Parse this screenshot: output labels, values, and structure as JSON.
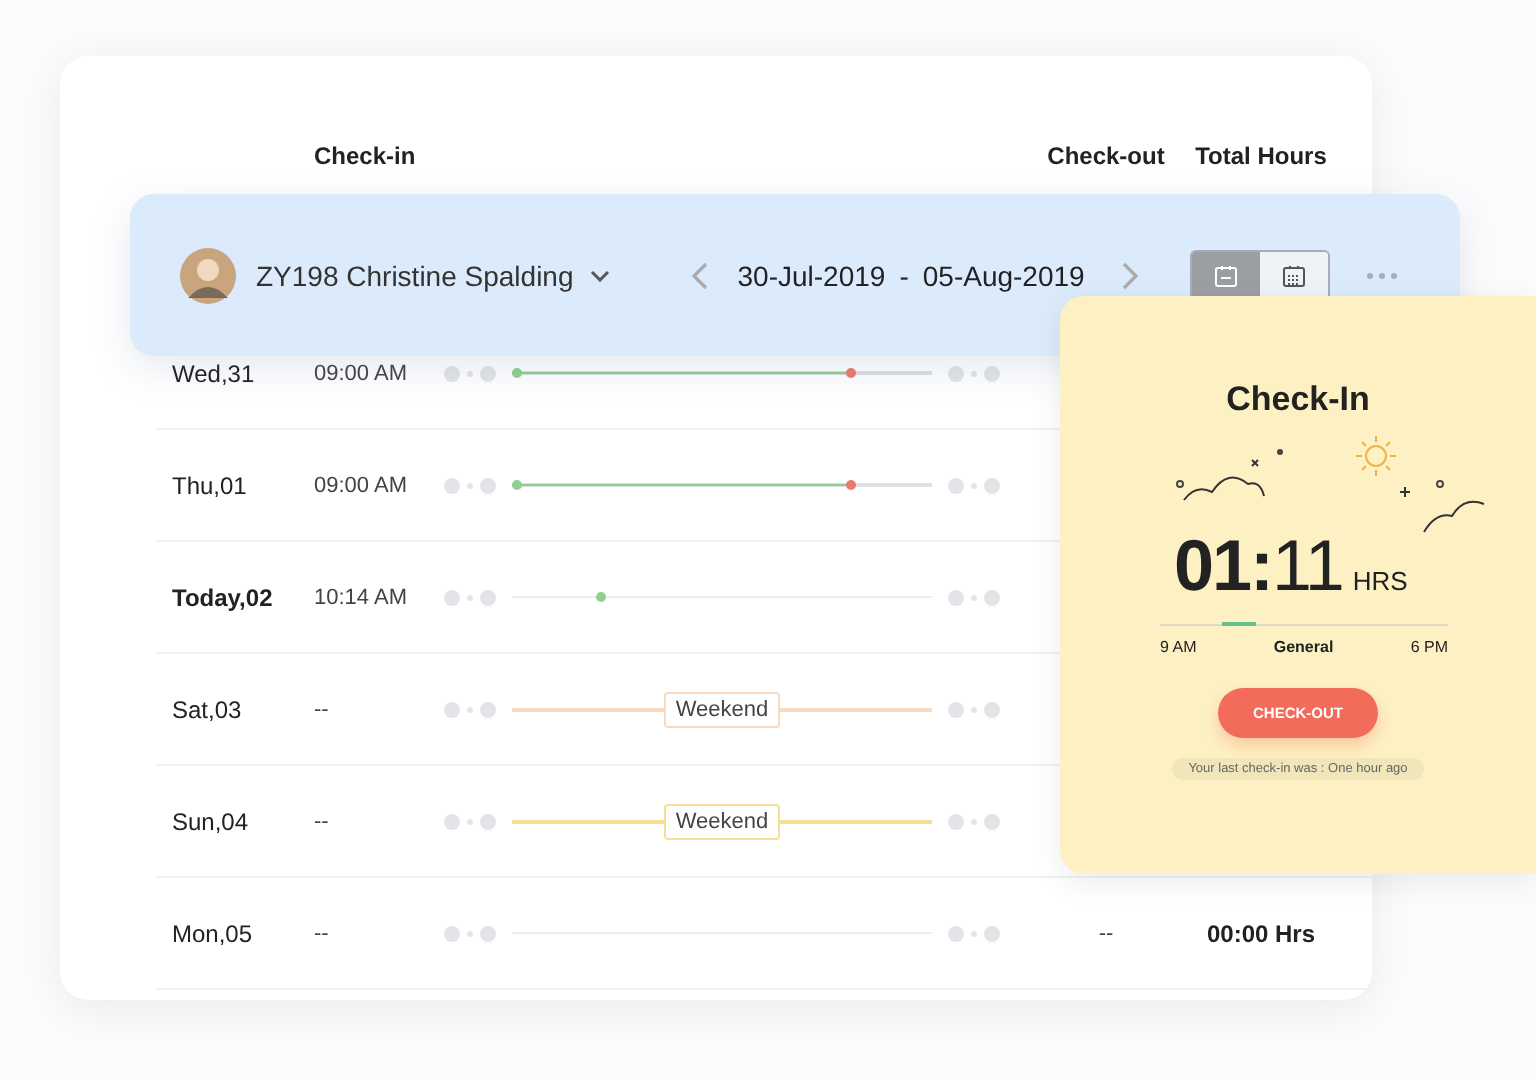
{
  "table": {
    "columns": [
      "Check-in",
      "Check-out",
      "Total Hours"
    ],
    "rows": [
      {
        "day": "Wed,31",
        "today": false,
        "check_in": "09:00 AM",
        "timeline": {
          "kind": "worked"
        }
      },
      {
        "day": "Thu,01",
        "today": false,
        "check_in": "09:00 AM",
        "timeline": {
          "kind": "worked"
        }
      },
      {
        "day": "Today,02",
        "today": true,
        "check_in": "10:14 AM",
        "timeline": {
          "kind": "active",
          "level": 0.2
        }
      },
      {
        "day": "Sat,03",
        "today": false,
        "check_in": "--",
        "timeline": {
          "kind": "weekend",
          "label": "Weekend",
          "color": "#f8d9bd"
        }
      },
      {
        "day": "Sun,04",
        "today": false,
        "check_in": "--",
        "timeline": {
          "kind": "weekend",
          "label": "Weekend",
          "color": "#f6df92"
        }
      },
      {
        "day": "Mon,05",
        "today": false,
        "check_in": "--",
        "timeline": {
          "kind": "none"
        },
        "check_out": "--",
        "total": "00:00 Hrs"
      }
    ]
  },
  "toolbar": {
    "employee": "ZY198 Christine Spalding",
    "date_from": "30-Jul-2019",
    "separator": "-",
    "date_to": "05-Aug-2019",
    "views": [
      {
        "kind": "day",
        "selected": true
      },
      {
        "kind": "month",
        "selected": false
      }
    ]
  },
  "check_in_card": {
    "title": "Check-In",
    "clock": "**01:**11",
    "unit": "HRS",
    "shift": {
      "start": "9 AM",
      "name": "General",
      "end": "6 PM",
      "level": 0.3
    },
    "button": "CHECK-OUT",
    "note": "Your last check-in was : One hour ago"
  }
}
